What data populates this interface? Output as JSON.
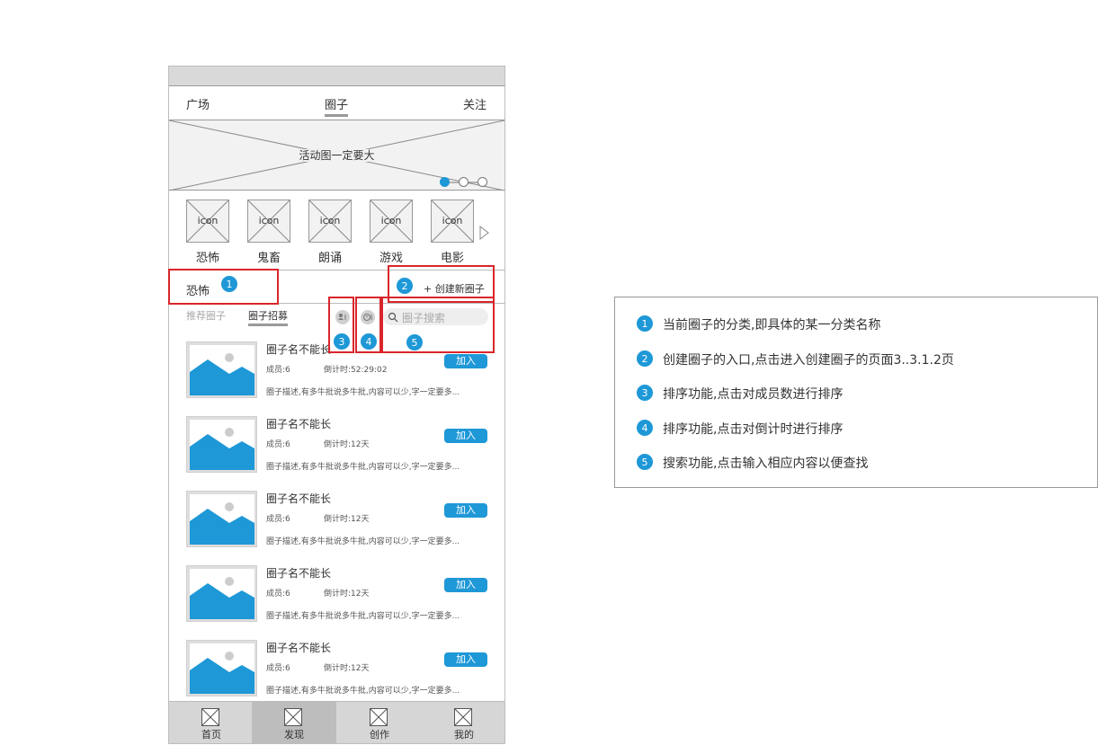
{
  "topnav": {
    "items": [
      "广场",
      "圈子",
      "关注"
    ],
    "active": "圈子"
  },
  "banner": {
    "text": "活动图一定要大",
    "dots": 3,
    "active_dot": 0
  },
  "categories": {
    "icon_placeholder": "icon",
    "items": [
      "恐怖",
      "鬼畜",
      "朗诵",
      "游戏",
      "电影"
    ]
  },
  "category_header": {
    "current": "恐怖",
    "create_label": "+ 创建新圈子"
  },
  "subtabs": {
    "recommended": "推荐圈子",
    "recruit": "圈子招募"
  },
  "search": {
    "placeholder": "圈子搜索"
  },
  "list": [
    {
      "name": "圈子名不能长",
      "members": "成员:6",
      "countdown": "倒计时:52:29:02",
      "join": "加入",
      "desc": "圈子描述,有多牛批说多牛批,内容可以少,字一定要多..."
    },
    {
      "name": "圈子名不能长",
      "members": "成员:6",
      "countdown": "倒计时:12天",
      "join": "加入",
      "desc": "圈子描述,有多牛批说多牛批,内容可以少,字一定要多..."
    },
    {
      "name": "圈子名不能长",
      "members": "成员:6",
      "countdown": "倒计时:12天",
      "join": "加入",
      "desc": "圈子描述,有多牛批说多牛批,内容可以少,字一定要多..."
    },
    {
      "name": "圈子名不能长",
      "members": "成员:6",
      "countdown": "倒计时:12天",
      "join": "加入",
      "desc": "圈子描述,有多牛批说多牛批,内容可以少,字一定要多..."
    },
    {
      "name": "圈子名不能长",
      "members": "成员:6",
      "countdown": "倒计时:12天",
      "join": "加入",
      "desc": "圈子描述,有多牛批说多牛批,内容可以少,字一定要多..."
    }
  ],
  "tabbar": {
    "items": [
      "首页",
      "发现",
      "创作",
      "我的"
    ],
    "active": "发现"
  },
  "annotations": {
    "badges": [
      "1",
      "2",
      "3",
      "4",
      "5"
    ]
  },
  "legend": {
    "items": [
      {
        "num": "1",
        "text": "当前圈子的分类,即具体的某一分类名称"
      },
      {
        "num": "2",
        "text": "创建圈子的入口,点击进入创建圈子的页面3..3.1.2页"
      },
      {
        "num": "3",
        "text": "排序功能,点击对成员数进行排序"
      },
      {
        "num": "4",
        "text": "排序功能,点击对倒计时进行排序"
      },
      {
        "num": "5",
        "text": "搜索功能,点击输入相应内容以便查找"
      }
    ]
  },
  "colors": {
    "accent": "#1e98d7",
    "annotation": "#d9262b",
    "placeholder_gray": "#dedede"
  }
}
